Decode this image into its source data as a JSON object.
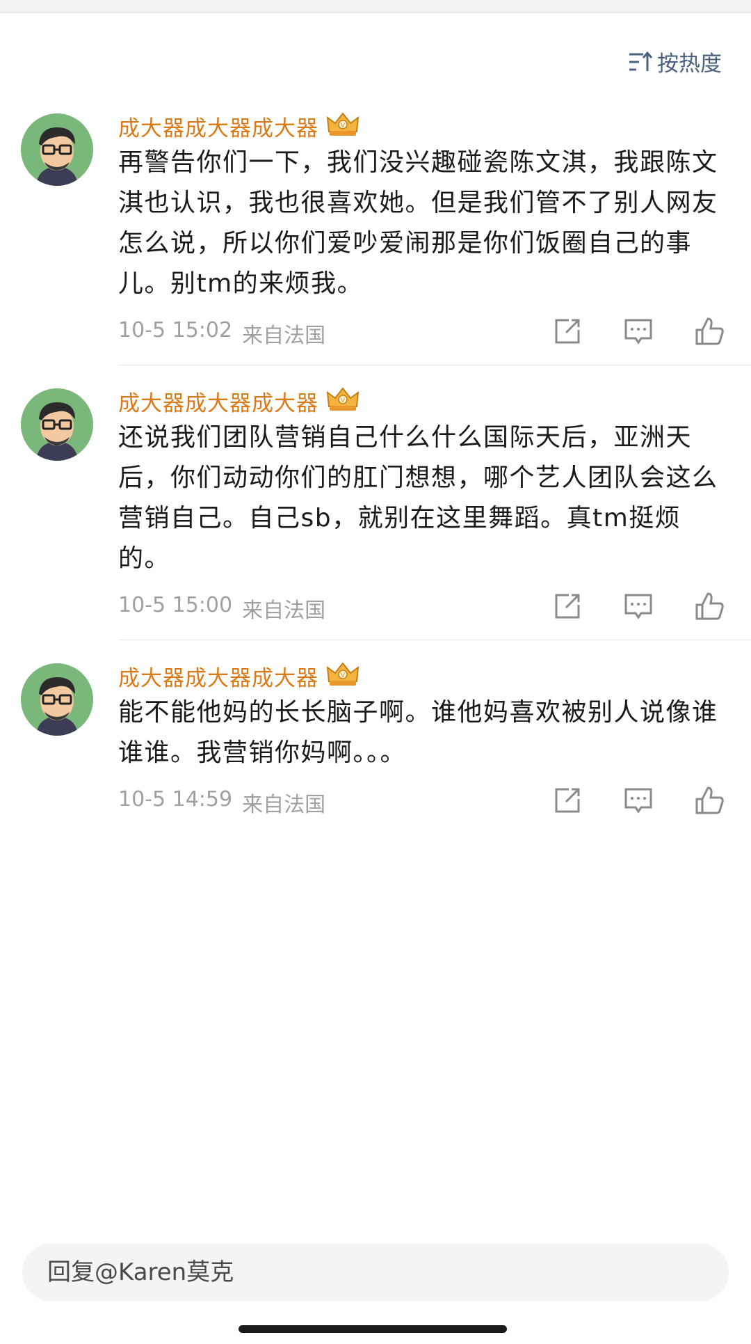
{
  "sort": {
    "label": "按热度",
    "icon": "sort-icon"
  },
  "comments": [
    {
      "username": "成大器成大器成大器",
      "badge_icon": "crown-badge-icon",
      "text": "再警告你们一下，我们没兴趣碰瓷陈文淇，我跟陈文淇也认识，我也很喜欢她。但是我们管不了别人网友怎么说，所以你们爱吵爱闹那是你们饭圈自己的事儿。别tm的来烦我。",
      "time": "10-5 15:02",
      "location": "来自法国"
    },
    {
      "username": "成大器成大器成大器",
      "badge_icon": "crown-badge-icon",
      "text": "还说我们团队营销自己什么什么国际天后，亚洲天后，你们动动你们的肛门想想，哪个艺人团队会这么营销自己。自己sb，就别在这里舞蹈。真tm挺烦的。",
      "time": "10-5 15:00",
      "location": "来自法国"
    },
    {
      "username": "成大器成大器成大器",
      "badge_icon": "crown-badge-icon",
      "text": "能不能他妈的长长脑子啊。谁他妈喜欢被别人说像谁谁谁。我营销你妈啊。。。",
      "time": "10-5 14:59",
      "location": "来自法国"
    }
  ],
  "reply": {
    "placeholder": "回复@Karen莫克"
  },
  "colors": {
    "username": "#d97a16",
    "meta": "#a0a0a0",
    "sort": "#4a607e",
    "avatar_bg": "#79b87a"
  }
}
